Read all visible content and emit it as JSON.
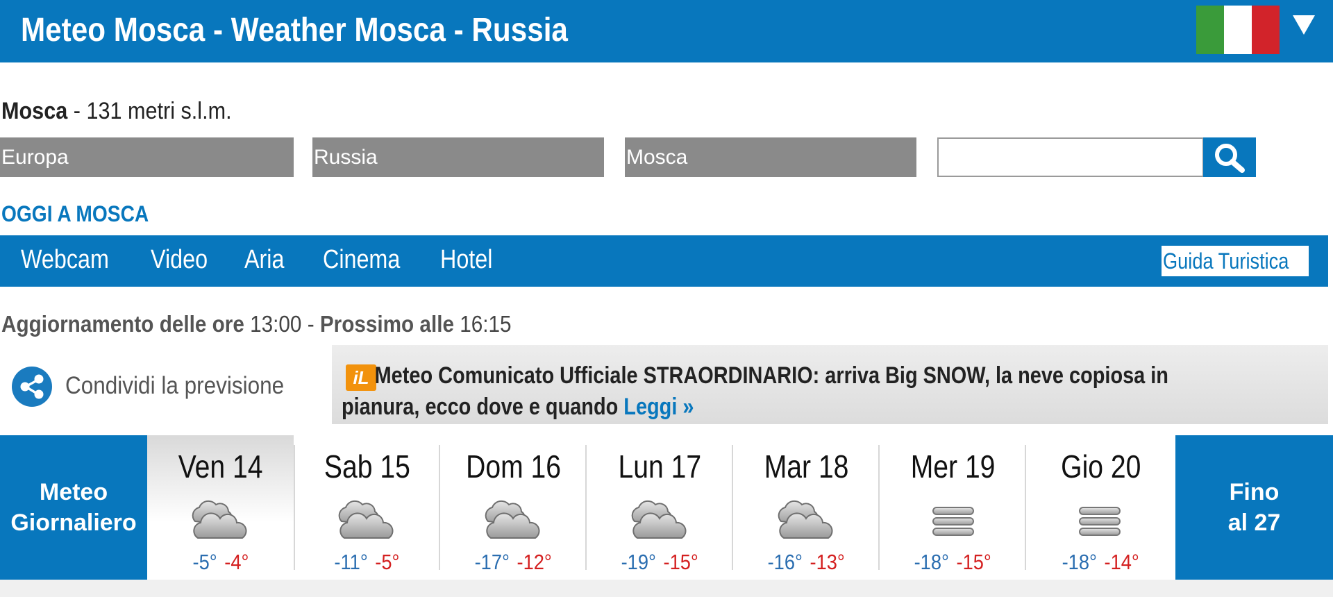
{
  "header": {
    "title": "Meteo Mosca - Weather Mosca - Russia",
    "flag_colors": [
      "#3a9b3a",
      "#ffffff",
      "#d2232a"
    ]
  },
  "location": {
    "city": "Mosca",
    "altitude": " - 131 metri s.l.m."
  },
  "selectors": {
    "continent": "Europa",
    "country": "Russia",
    "city": "Mosca",
    "search_value": ""
  },
  "today_label": "OGGI A MOSCA",
  "nav": {
    "items": [
      "Webcam",
      "Video",
      "Aria",
      "Cinema",
      "Hotel"
    ],
    "guide": "Guida Turistica"
  },
  "update": {
    "label": "Aggiornamento delle ore",
    "time": "13:00",
    "sep": " - ",
    "next_label": "Prossimo alle",
    "next_time": "16:15"
  },
  "share": {
    "label": "Condividi la previsione"
  },
  "news": {
    "logo": "iL",
    "line1": "Meteo Comunicato Ufficiale STRAORDINARIO: arriva Big SNOW, la neve copiosa in",
    "line2": "pianura, ecco dove e quando",
    "link": "Leggi »"
  },
  "forecast": {
    "daily_label_1": "Meteo",
    "daily_label_2": "Giornaliero",
    "more_label_1": "Fino",
    "more_label_2": "al 27",
    "days": [
      {
        "name": "Ven 14",
        "icon": "cloudy-icon",
        "min": "-5°",
        "max": "-4°"
      },
      {
        "name": "Sab 15",
        "icon": "cloudy-icon",
        "min": "-11°",
        "max": "-5°"
      },
      {
        "name": "Dom 16",
        "icon": "cloudy-icon",
        "min": "-17°",
        "max": "-12°"
      },
      {
        "name": "Lun 17",
        "icon": "cloudy-icon",
        "min": "-19°",
        "max": "-15°"
      },
      {
        "name": "Mar 18",
        "icon": "cloudy-icon",
        "min": "-16°",
        "max": "-13°"
      },
      {
        "name": "Mer 19",
        "icon": "fog-icon",
        "min": "-18°",
        "max": "-15°"
      },
      {
        "name": "Gio 20",
        "icon": "fog-icon",
        "min": "-18°",
        "max": "-14°"
      }
    ]
  }
}
